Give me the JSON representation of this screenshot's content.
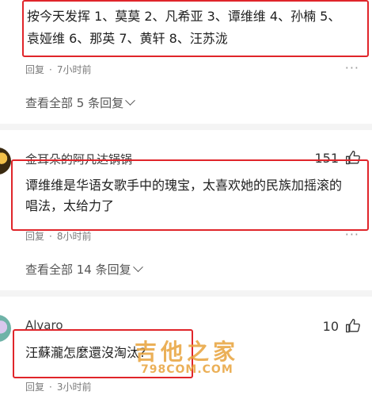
{
  "comments": [
    {
      "text_lines": [
        "按今天发挥 1、莫莫 2、凡希亚 3、谭维维 4、孙楠 5、",
        "袁娅维 6、那英 7、黄轩 8、汪苏泷"
      ],
      "reply_label": "回复",
      "time": "7小时前",
      "view_replies": "查看全部 5 条回复"
    },
    {
      "username": "金耳朵的阿凡达锅锅",
      "likes": "151",
      "text_lines": [
        "谭维维是华语女歌手中的瑰宝，太喜欢她的民族加摇滚的",
        "唱法，太给力了"
      ],
      "reply_label": "回复",
      "time": "8小时前",
      "view_replies": "查看全部 14 条回复"
    },
    {
      "username": "Alvaro",
      "likes": "10",
      "text_lines": [
        "汪蘇瀧怎麼還沒淘汰?"
      ],
      "reply_label": "回复",
      "time": "3小时前"
    }
  ],
  "meta_separator": "·",
  "more_glyph": "···",
  "watermark": {
    "cn": "吉他之家",
    "en": "798COM.COM"
  },
  "colors": {
    "highlight": "#e0252a",
    "watermark": "#e8a33b"
  }
}
